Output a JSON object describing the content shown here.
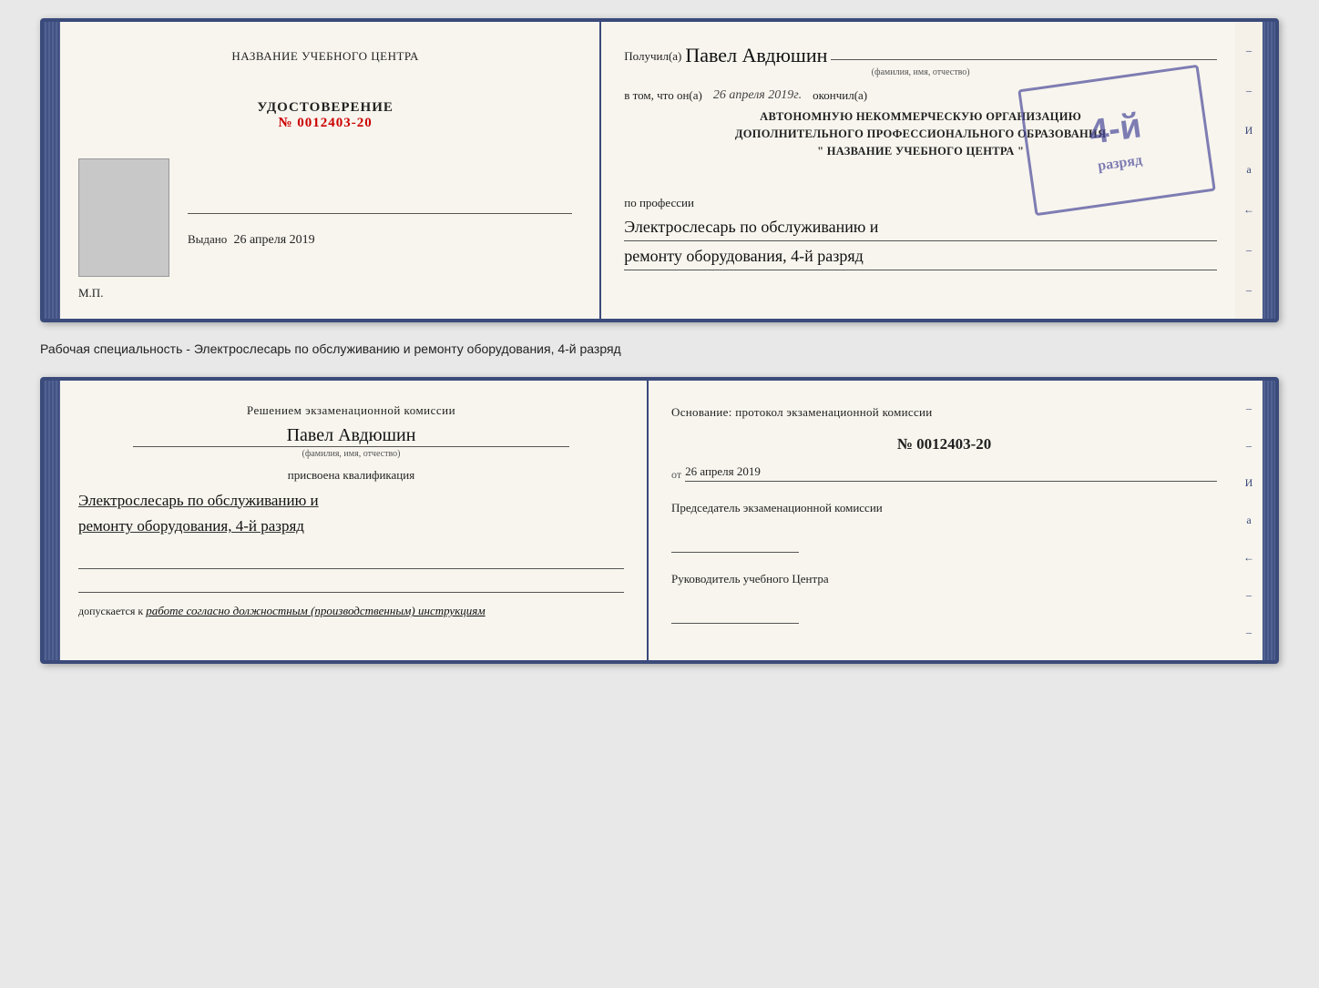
{
  "top_book": {
    "left_page": {
      "center_label": "НАЗВАНИЕ УЧЕБНОГО ЦЕНТРА",
      "udost_title": "УДОСТОВЕРЕНИЕ",
      "udost_number": "№ 0012403-20",
      "vydano_label": "Выдано",
      "vydano_date": "26 апреля 2019",
      "mp_label": "М.П."
    },
    "right_page": {
      "poluchil_label": "Получил(а)",
      "recipient_name": "Павел Авдюшин",
      "fio_sub": "(фамилия, имя, отчество)",
      "vtom_label": "в том, что он(а)",
      "date_text": "26 апреля 2019г.",
      "okoncil_label": "окончил(а)",
      "org_line1": "АВТОНОМНУЮ НЕКОММЕРЧЕСКУЮ ОРГАНИЗАЦИЮ",
      "org_line2": "ДОПОЛНИТЕЛЬНОГО ПРОФЕССИОНАЛЬНОГО ОБРАЗОВАНИЯ",
      "org_line3": "\" НАЗВАНИЕ УЧЕБНОГО ЦЕНТРА \"",
      "po_professii_label": "по профессии",
      "profession_line1": "Электрослесарь по обслуживанию и",
      "profession_line2": "ремонту оборудования, 4-й разряд",
      "stamp_line1": "4-й ра",
      "stamp_big": "4-й разряд"
    }
  },
  "separator": {
    "text": "Рабочая специальность - Электрослесарь по обслуживанию и ремонту оборудования, 4-й разряд"
  },
  "bottom_book": {
    "left_page": {
      "resheniyem_label": "Решением экзаменационной комиссии",
      "name": "Павел Авдюшин",
      "fio_sub": "(фамилия, имя, отчество)",
      "prisvoena_label": "присвоена квалификация",
      "qualif_line1": "Электрослесарь по обслуживанию и",
      "qualif_line2": "ремонту оборудования, 4-й разряд",
      "dopusk_label": "допускается к",
      "dopusk_text": "работе согласно должностным (производственным) инструкциям"
    },
    "right_page": {
      "osnovanie_label": "Основание: протокол экзаменационной комиссии",
      "protocol_number": "№ 0012403-20",
      "ot_label": "от",
      "ot_date": "26 апреля 2019",
      "predsedatel_label": "Председатель экзаменационной комиссии",
      "rukovoditel_label": "Руководитель учебного Центра"
    }
  },
  "deco": {
    "right_chars": [
      "И",
      "а",
      "←",
      "–",
      "–",
      "–",
      "–"
    ]
  }
}
